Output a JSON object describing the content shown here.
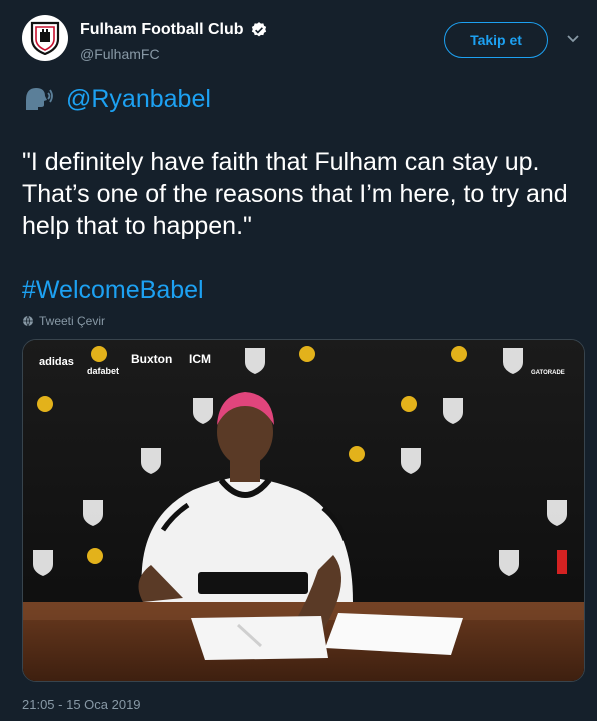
{
  "account": {
    "name": "Fulham Football Club",
    "handle": "@FulhamFC",
    "verified_icon": "verified-badge-icon",
    "avatar_icon": "fulham-crest-icon"
  },
  "actions": {
    "follow_label": "Takip et",
    "more_icon": "chevron-down-icon"
  },
  "tweet": {
    "emoji_icon": "speaking-head-emoji",
    "mention": "@Ryanbabel",
    "quote": "\"I definitely have faith that Fulham can stay up. That’s one of the reasons that I’m here, to try and help that to happen.\"",
    "hashtag": "#WelcomeBabel",
    "translate_label": "Tweeti Çevir",
    "translate_icon": "globe-icon",
    "timestamp": "21:05 - 15 Oca 2019"
  },
  "media": {
    "sponsor_logos": [
      "adidas",
      "dafabet",
      "Buxton",
      "ICM",
      "GATORADE"
    ]
  },
  "colors": {
    "background": "#15202b",
    "accent": "#1da1f2",
    "muted": "#8899a6"
  }
}
